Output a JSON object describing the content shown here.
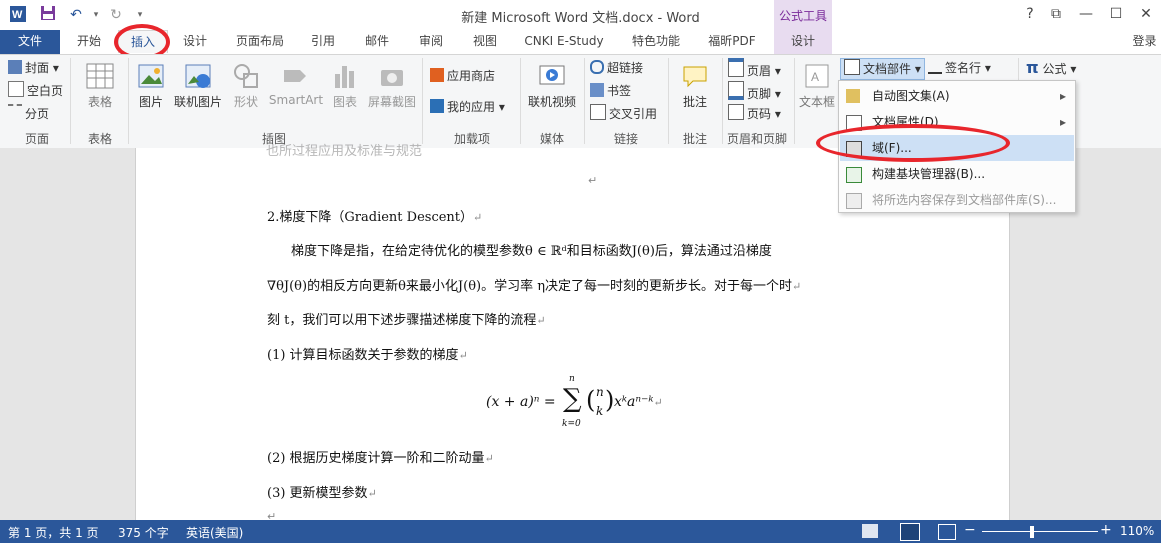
{
  "window": {
    "title": "新建 Microsoft Word 文档.docx - Word",
    "context_tab_group": "公式工具",
    "controls": [
      "?",
      "⧉",
      "—",
      "☐",
      "✕"
    ],
    "signin": "登录"
  },
  "tabs": [
    "文件",
    "开始",
    "插入",
    "设计",
    "页面布局",
    "引用",
    "邮件",
    "审阅",
    "视图",
    "CNKI E-Study",
    "特色功能",
    "福昕PDF",
    "设计"
  ],
  "ribbon": {
    "pages": {
      "items": [
        "封面",
        "空白页",
        "分页"
      ],
      "group": "页面"
    },
    "tables": {
      "button": "表格",
      "group": "表格"
    },
    "illustrations": {
      "buttons": [
        "图片",
        "联机图片",
        "形状",
        "SmartArt",
        "图表",
        "屏幕截图"
      ],
      "group": "插图"
    },
    "addins": {
      "items": [
        "应用商店",
        "我的应用"
      ],
      "group": "加载项"
    },
    "media": {
      "button": "联机视频",
      "group": "媒体"
    },
    "links": {
      "items": [
        "超链接",
        "书签",
        "交叉引用"
      ],
      "group": "链接"
    },
    "comments": {
      "button": "批注",
      "group": "批注"
    },
    "header_footer": {
      "items": [
        "页眉",
        "页脚",
        "页码"
      ],
      "group": "页眉和页脚"
    },
    "text": {
      "button": "文本框",
      "quickparts": "文档部件",
      "signature": "签名行",
      "equation": "公式"
    }
  },
  "menu": {
    "items": [
      {
        "label": "自动图文集(A)",
        "arrow": "▸"
      },
      {
        "label": "文档属性(D)",
        "arrow": "▸"
      },
      {
        "label": "域(F)...",
        "arrow": ""
      },
      {
        "label": "构建基块管理器(B)...",
        "arrow": ""
      },
      {
        "label": "将所选内容保存到文档部件库(S)...",
        "arrow": ""
      }
    ]
  },
  "document": {
    "cut_top": "也所过程应用及标准与规范",
    "lines": [
      "2.梯度下降（Gradient Descent）",
      "梯度下降是指，在给定待优化的模型参数θ ∈ ℝᵈ和目标函数J(θ)后，算法通过沿梯度",
      "∇θJ(θ)的相反方向更新θ来最小化J(θ)。学习率 η决定了每一时刻的更新步长。对于每一个时",
      "刻 t，我们可以用下述步骤描述梯度下降的流程",
      "(1)  计算目标函数关于参数的梯度",
      "(2)  根据历史梯度计算一阶和二阶动量",
      "(3)  更新模型参数"
    ],
    "formula": {
      "lhs": "(x + a)ⁿ =",
      "sum_top": "n",
      "sum_sym": "∑",
      "sum_bottom": "k=0",
      "binom_top": "n",
      "binom_bottom": "k",
      "rhs": "xᵏaⁿ⁻ᵏ"
    },
    "para_mark": "↵"
  },
  "status": {
    "page": "第 1 页，共 1 页",
    "words": "375 个字",
    "language": "英语(美国)",
    "zoom": "110%"
  }
}
